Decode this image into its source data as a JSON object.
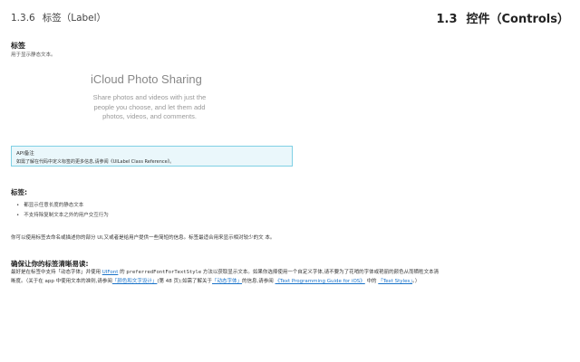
{
  "header": {
    "section_number": "1.3.6",
    "section_title": "标签（Label）",
    "chapter_number": "1.3",
    "chapter_title": "控件（Controls）"
  },
  "intro": {
    "title": "标签",
    "subtitle": "用于显示静态文本。"
  },
  "sample": {
    "title": "iCloud Photo Sharing",
    "body": "Share photos and videos with just the people you choose, and let them add photos, videos, and comments."
  },
  "note": {
    "title": "API备注",
    "body": "如需了解在代码中定义标签的更多信息,请参阅《UILabel Class Reference》。"
  },
  "labels_section": {
    "heading": "标签:",
    "bullets": [
      "都显示任意长度的静态文本",
      "不支持除复制文本之外的用户交互行为"
    ]
  },
  "paragraph1": "你可以使用标签去命名或描述你的部分 UI,又或者是给用户提供一些简短的信息。标签最适合用来显示相对较少的文 本。",
  "legibility_section": {
    "heading": "确保让你的标签清晰易读:",
    "line1_a": "最好是在标签中支持「动态字体」并使用 ",
    "line1_link": "UIFont",
    "line1_b": " 的 ",
    "line1_code": "preferredFontForTextStyle",
    "line1_c": " 方法以获取显示文本。如果你选择使用一个自定义字体,请不要为了花哨的字体或艳丽的颜色从而牺牲文本清",
    "line2_a": "晰度。（关于在 app 中使用文本的准则,请参阅",
    "line2_link1": "「颜色和文字设计」",
    "line2_b": "(第 48 页);如需了解关于",
    "line2_link2": "「动态字体」",
    "line2_c": "的信息,请参阅 ",
    "line2_link3": "《Text Programming Guide for iOS》",
    "line2_d": " 中的 ",
    "line2_link4": "「Text Styles」",
    "line2_e": "。）"
  },
  "colors": {
    "link": "#1a73c9",
    "note_border": "#7fd0e4",
    "note_background": "#eaf7fb"
  }
}
